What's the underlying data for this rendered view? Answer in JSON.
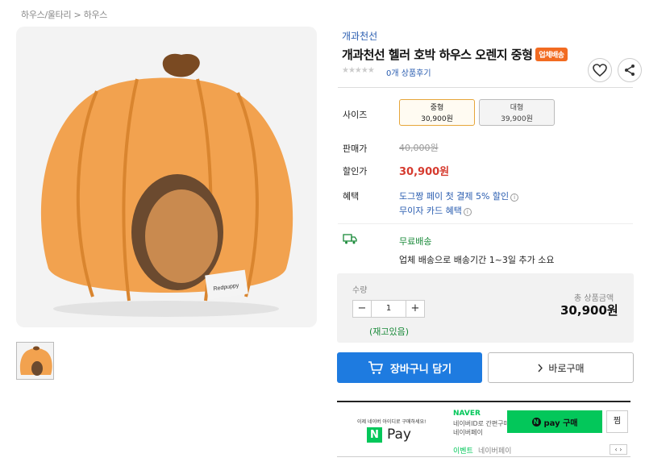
{
  "breadcrumb": "하우스/울타리 > 하우스",
  "product": {
    "brand": "개과천선",
    "title": "개과천선 헬러 호박 하우스 오렌지 중형",
    "badge": "업체배송",
    "stars": "★★★★★",
    "review_count": "0개 상품후기"
  },
  "options": {
    "size_label": "사이즈",
    "sizes": [
      {
        "name": "중형",
        "price": "30,900원",
        "selected": true
      },
      {
        "name": "대형",
        "price": "39,900원",
        "selected": false
      }
    ]
  },
  "pricing": {
    "list_label": "판매가",
    "list_price": "40,000원",
    "sale_label": "할인가",
    "sale_price": "30,900원",
    "benefit_label": "혜택",
    "benefit_1": "도그짱 페이 첫 결제 5% 할인",
    "benefit_2": "무이자 카드 혜택"
  },
  "shipping": {
    "title": "무료배송",
    "desc": "업체 배송으로 배송기간 1~3일 추가 소요"
  },
  "quantity": {
    "label": "수량",
    "value": "1",
    "minus": "−",
    "plus": "+",
    "stock": "(재고있음)",
    "total_label": "총 상품금액",
    "total_value": "30,900원"
  },
  "actions": {
    "cart": "장바구니 담기",
    "buy": "바로구매"
  },
  "npay": {
    "small_text": "이제 네이버 아이디로 구매하세요!",
    "pay_n": "N",
    "pay_text": "Pay",
    "naver": "NAVER",
    "line1": "네이버ID로 간편구매",
    "line2": "네이버페이",
    "buy_label": "pay 구매",
    "zzim": "찜",
    "event_label": "이벤트",
    "event_text": "네이버페이",
    "pager": "‹ ›"
  },
  "colors": {
    "accent_blue": "#1e7be0",
    "sale_red": "#d63b2f",
    "badge_orange": "#f26b21",
    "naver_green": "#03c75a",
    "pumpkin": "#f0a04a"
  },
  "icons": {
    "heart": "heart-icon",
    "share": "share-icon",
    "truck": "truck-icon",
    "cart": "cart-icon",
    "chevron": "chevron-right-icon"
  }
}
